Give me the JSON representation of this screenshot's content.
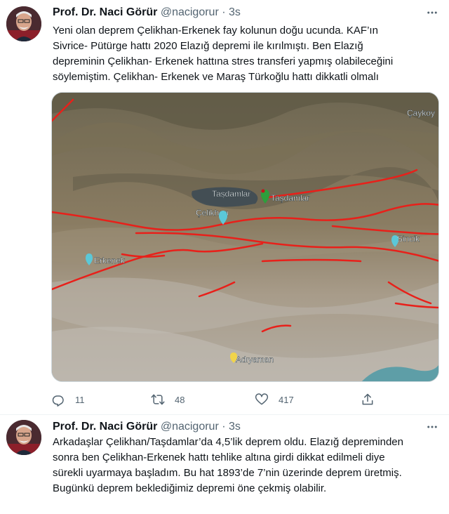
{
  "tweets": [
    {
      "author_name": "Prof. Dr. Naci Görür",
      "handle": "@nacigorur",
      "separator": "·",
      "time": "3s",
      "lines": [
        "Yeni olan deprem Çelikhan-Erkenek fay kolunun doğu ucunda. KAF’ın",
        "Sivrice- Pütürge hattı 2020 Elazığ depremi ile kırılmıştı. Ben Elazığ",
        "depreminin Çelikhan- Erkenek hattına stres transferi yapmış olabileceğini",
        "söylemiştim. Çelikhan- Erkenek ve Maraş Türkoğlu hattı dikkatli olmalı"
      ],
      "media": {
        "place_labels": [
          "Çaykoy",
          "Taşdamlar",
          "Taşdamlar",
          "Çelikhan",
          "Sincik",
          "Erkenek",
          "Adıyaman"
        ],
        "fault_color": "#e8201a",
        "pin_color": "#5bc8d8"
      },
      "actions": {
        "reply_count": "11",
        "retweet_count": "48",
        "like_count": "417"
      }
    },
    {
      "author_name": "Prof. Dr. Naci Görür",
      "handle": "@nacigorur",
      "separator": "·",
      "time": "3s",
      "lines": [
        "Arkadaşlar Çelikhan/Taşdamlar’da 4,5’lik deprem oldu. Elazığ depreminden",
        "sonra ben Çelikhan-Erkenek hattı tehlike altına girdi dikkat edilmeli diye",
        "sürekli uyarmaya başladım. Bu hat 1893’de 7’nin üzerinde deprem üretmiş.",
        "Bugünkü deprem beklediğimiz depremi öne çekmiş olabilir."
      ]
    }
  ],
  "colors": {
    "text": "#0f1419",
    "secondary": "#536471",
    "divider": "#eff3f4"
  },
  "icons": {
    "more": "more-icon",
    "reply": "reply-icon",
    "retweet": "retweet-icon",
    "like": "like-icon",
    "share": "share-icon"
  }
}
